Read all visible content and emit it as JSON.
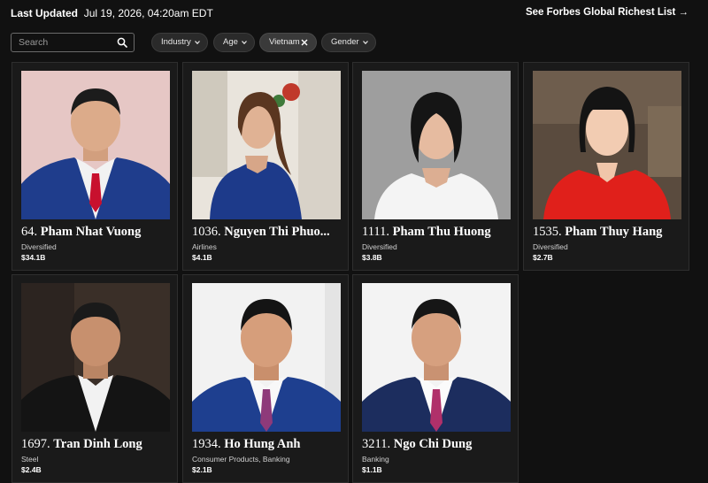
{
  "header": {
    "last_updated_label": "Last Updated",
    "last_updated_value": "Jul 19, 2026, 04:20am EDT",
    "global_link": "See Forbes Global Richest List →"
  },
  "filters": {
    "search_placeholder": "Search",
    "industry": "Industry",
    "age": "Age",
    "country": "Vietnam",
    "gender": "Gender"
  },
  "people": [
    {
      "rank": "64.",
      "name": "Pham Nhat Vuong",
      "industry": "Diversified",
      "worth": "$34.1B"
    },
    {
      "rank": "1036.",
      "name": "Nguyen Thi Phuo...",
      "industry": "Airlines",
      "worth": "$4.1B"
    },
    {
      "rank": "1111.",
      "name": "Pham Thu Huong",
      "industry": "Diversified",
      "worth": "$3.8B"
    },
    {
      "rank": "1535.",
      "name": "Pham Thuy Hang",
      "industry": "Diversified",
      "worth": "$2.7B"
    },
    {
      "rank": "1697.",
      "name": "Tran Dinh Long",
      "industry": "Steel",
      "worth": "$2.4B"
    },
    {
      "rank": "1934.",
      "name": "Ho Hung Anh",
      "industry": "Consumer Products, Banking",
      "worth": "$2.1B"
    },
    {
      "rank": "3211.",
      "name": "Ngo Chi Dung",
      "industry": "Banking",
      "worth": "$1.1B"
    }
  ]
}
